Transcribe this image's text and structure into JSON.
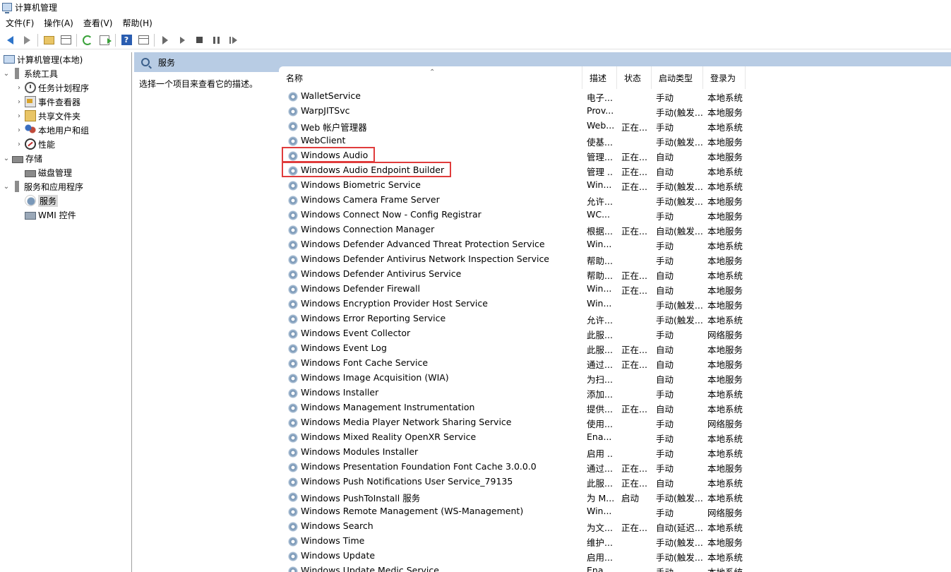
{
  "window": {
    "title": "计算机管理"
  },
  "menu": [
    "文件(F)",
    "操作(A)",
    "查看(V)",
    "帮助(H)"
  ],
  "toolbar": {
    "buttons": [
      "back-icon",
      "forward-icon",
      "up-folder-icon",
      "show-hide-tree-icon",
      "refresh-icon",
      "export-list-icon",
      "help-icon",
      "show-action-pane-icon",
      "start-service-icon",
      "start-service-alt-icon",
      "stop-service-icon",
      "pause-service-icon",
      "restart-service-icon"
    ]
  },
  "tree": [
    {
      "label": "计算机管理(本地)",
      "icon": "computer-icon",
      "level": 0,
      "twisty": ""
    },
    {
      "label": "系统工具",
      "icon": "tools-icon",
      "level": 0,
      "twisty": "v"
    },
    {
      "label": "任务计划程序",
      "icon": "clock-icon",
      "level": 1,
      "twisty": ">"
    },
    {
      "label": "事件查看器",
      "icon": "event-viewer-icon",
      "level": 1,
      "twisty": ">"
    },
    {
      "label": "共享文件夹",
      "icon": "shared-folder-icon",
      "level": 1,
      "twisty": ">"
    },
    {
      "label": "本地用户和组",
      "icon": "users-icon",
      "level": 1,
      "twisty": ">"
    },
    {
      "label": "性能",
      "icon": "performance-icon",
      "level": 1,
      "twisty": ">"
    },
    {
      "label": "存储",
      "icon": "storage-icon",
      "level": 0,
      "twisty": "v"
    },
    {
      "label": "磁盘管理",
      "icon": "disk-icon",
      "level": 1,
      "twisty": ""
    },
    {
      "label": "服务和应用程序",
      "icon": "apps-icon",
      "level": 0,
      "twisty": "v"
    },
    {
      "label": "服务",
      "icon": "services-icon",
      "level": 1,
      "twisty": "",
      "selected": true
    },
    {
      "label": "WMI 控件",
      "icon": "wmi-icon",
      "level": 1,
      "twisty": ""
    }
  ],
  "panel": {
    "title": "服务",
    "description": "选择一个项目来查看它的描述。",
    "header_color": "#b8cce4"
  },
  "columns": {
    "name": "名称",
    "description": "描述",
    "status": "状态",
    "startup": "启动类型",
    "logon": "登录为"
  },
  "services": [
    {
      "name": "WalletService",
      "description": "电子...",
      "status": "",
      "startup": "手动",
      "logon": "本地系统"
    },
    {
      "name": "WarpJITSvc",
      "description": "Prov...",
      "status": "",
      "startup": "手动(触发...",
      "logon": "本地服务"
    },
    {
      "name": "Web 帐户管理器",
      "description": "Web...",
      "status": "正在...",
      "startup": "手动",
      "logon": "本地系统"
    },
    {
      "name": "WebClient",
      "description": "使基...",
      "status": "",
      "startup": "手动(触发...",
      "logon": "本地服务"
    },
    {
      "name": "Windows Audio",
      "description": "管理...",
      "status": "正在...",
      "startup": "自动",
      "logon": "本地服务",
      "highlighted": true
    },
    {
      "name": "Windows Audio Endpoint Builder",
      "description": "管理 ...",
      "status": "正在...",
      "startup": "自动",
      "logon": "本地系统",
      "highlighted": true
    },
    {
      "name": "Windows Biometric Service",
      "description": "Win...",
      "status": "正在...",
      "startup": "手动(触发...",
      "logon": "本地系统"
    },
    {
      "name": "Windows Camera Frame Server",
      "description": "允许...",
      "status": "",
      "startup": "手动(触发...",
      "logon": "本地服务"
    },
    {
      "name": "Windows Connect Now - Config Registrar",
      "description": "WC...",
      "status": "",
      "startup": "手动",
      "logon": "本地服务"
    },
    {
      "name": "Windows Connection Manager",
      "description": "根据...",
      "status": "正在...",
      "startup": "自动(触发...",
      "logon": "本地服务"
    },
    {
      "name": "Windows Defender Advanced Threat Protection Service",
      "description": "Win...",
      "status": "",
      "startup": "手动",
      "logon": "本地系统"
    },
    {
      "name": "Windows Defender Antivirus Network Inspection Service",
      "description": "帮助...",
      "status": "",
      "startup": "手动",
      "logon": "本地服务"
    },
    {
      "name": "Windows Defender Antivirus Service",
      "description": "帮助...",
      "status": "正在...",
      "startup": "自动",
      "logon": "本地系统"
    },
    {
      "name": "Windows Defender Firewall",
      "description": "Win...",
      "status": "正在...",
      "startup": "自动",
      "logon": "本地服务"
    },
    {
      "name": "Windows Encryption Provider Host Service",
      "description": "Win...",
      "status": "",
      "startup": "手动(触发...",
      "logon": "本地服务"
    },
    {
      "name": "Windows Error Reporting Service",
      "description": "允许...",
      "status": "",
      "startup": "手动(触发...",
      "logon": "本地系统"
    },
    {
      "name": "Windows Event Collector",
      "description": "此服...",
      "status": "",
      "startup": "手动",
      "logon": "网络服务"
    },
    {
      "name": "Windows Event Log",
      "description": "此服...",
      "status": "正在...",
      "startup": "自动",
      "logon": "本地服务"
    },
    {
      "name": "Windows Font Cache Service",
      "description": "通过...",
      "status": "正在...",
      "startup": "自动",
      "logon": "本地服务"
    },
    {
      "name": "Windows Image Acquisition (WIA)",
      "description": "为扫...",
      "status": "",
      "startup": "自动",
      "logon": "本地服务"
    },
    {
      "name": "Windows Installer",
      "description": "添加...",
      "status": "",
      "startup": "手动",
      "logon": "本地系统"
    },
    {
      "name": "Windows Management Instrumentation",
      "description": "提供...",
      "status": "正在...",
      "startup": "自动",
      "logon": "本地系统"
    },
    {
      "name": "Windows Media Player Network Sharing Service",
      "description": "使用...",
      "status": "",
      "startup": "手动",
      "logon": "网络服务"
    },
    {
      "name": "Windows Mixed Reality OpenXR Service",
      "description": "Ena...",
      "status": "",
      "startup": "手动",
      "logon": "本地系统"
    },
    {
      "name": "Windows Modules Installer",
      "description": "启用 ...",
      "status": "",
      "startup": "手动",
      "logon": "本地系统"
    },
    {
      "name": "Windows Presentation Foundation Font Cache 3.0.0.0",
      "description": "通过...",
      "status": "正在...",
      "startup": "手动",
      "logon": "本地服务"
    },
    {
      "name": "Windows Push Notifications User Service_79135",
      "description": "此服...",
      "status": "正在...",
      "startup": "自动",
      "logon": "本地系统"
    },
    {
      "name": "Windows PushToInstall 服务",
      "description": "为 M...",
      "status": "启动",
      "startup": "手动(触发...",
      "logon": "本地系统"
    },
    {
      "name": "Windows Remote Management (WS-Management)",
      "description": "Win...",
      "status": "",
      "startup": "手动",
      "logon": "网络服务"
    },
    {
      "name": "Windows Search",
      "description": "为文...",
      "status": "正在...",
      "startup": "自动(延迟...",
      "logon": "本地系统"
    },
    {
      "name": "Windows Time",
      "description": "维护...",
      "status": "",
      "startup": "手动(触发...",
      "logon": "本地服务"
    },
    {
      "name": "Windows Update",
      "description": "启用...",
      "status": "",
      "startup": "手动(触发...",
      "logon": "本地系统"
    },
    {
      "name": "Windows Update Medic Service",
      "description": "Ena...",
      "status": "",
      "startup": "手动",
      "logon": "本地系统"
    }
  ],
  "highlight_color": "#e03c3c"
}
